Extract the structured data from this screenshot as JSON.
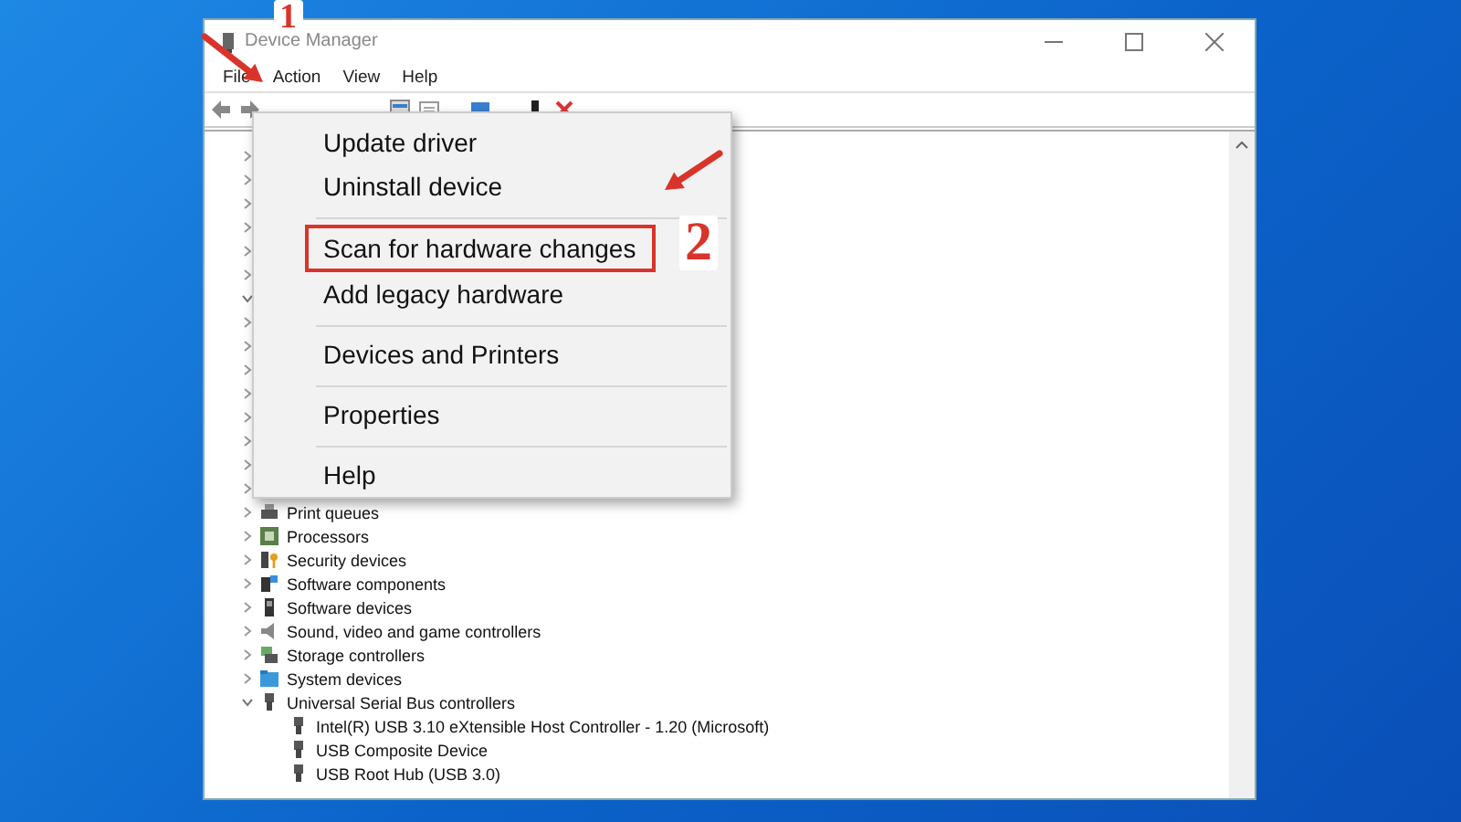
{
  "window": {
    "title": "Device Manager"
  },
  "menu_bar": [
    "File",
    "Action",
    "View",
    "Help"
  ],
  "tree": {
    "covered_rows": [
      {
        "expanded": false
      },
      {
        "expanded": false
      },
      {
        "expanded": false
      },
      {
        "expanded": false
      },
      {
        "expanded": false
      },
      {
        "expanded": false
      },
      {
        "expanded": true
      },
      {
        "expanded": false
      },
      {
        "expanded": false
      },
      {
        "expanded": false
      },
      {
        "expanded": false
      },
      {
        "expanded": false
      },
      {
        "expanded": false
      },
      {
        "expanded": false
      },
      {
        "expanded": false
      }
    ],
    "items": [
      {
        "label": "Print queues",
        "kind": "printer",
        "expanded": false
      },
      {
        "label": "Processors",
        "kind": "chip",
        "expanded": false
      },
      {
        "label": "Security devices",
        "kind": "key",
        "expanded": false
      },
      {
        "label": "Software components",
        "kind": "component",
        "expanded": false
      },
      {
        "label": "Software devices",
        "kind": "device",
        "expanded": false
      },
      {
        "label": "Sound, video and game controllers",
        "kind": "speaker",
        "expanded": false
      },
      {
        "label": "Storage controllers",
        "kind": "storage",
        "expanded": false
      },
      {
        "label": "System devices",
        "kind": "folder",
        "expanded": false
      },
      {
        "label": "Universal Serial Bus controllers",
        "kind": "usb",
        "expanded": true,
        "children": [
          {
            "label": "Intel(R) USB 3.10 eXtensible Host Controller - 1.20 (Microsoft)",
            "kind": "usb"
          },
          {
            "label": "USB Composite Device",
            "kind": "usb"
          },
          {
            "label": "USB Root Hub (USB 3.0)",
            "kind": "usb"
          }
        ]
      }
    ]
  },
  "context_menu": {
    "items": [
      {
        "label": "Update driver",
        "annotated": false,
        "separator_after": false
      },
      {
        "label": "Uninstall device",
        "annotated": false,
        "separator_after": true
      },
      {
        "label": "Scan for hardware changes",
        "annotated": true,
        "separator_after": false
      },
      {
        "label": "Add legacy hardware",
        "annotated": false,
        "separator_after": true
      },
      {
        "label": "Devices and Printers",
        "annotated": false,
        "separator_after": true
      },
      {
        "label": "Properties",
        "annotated": false,
        "separator_after": true
      },
      {
        "label": "Help",
        "annotated": false,
        "separator_after": false
      }
    ]
  },
  "annotations": [
    {
      "number": "1"
    },
    {
      "number": "2"
    }
  ]
}
